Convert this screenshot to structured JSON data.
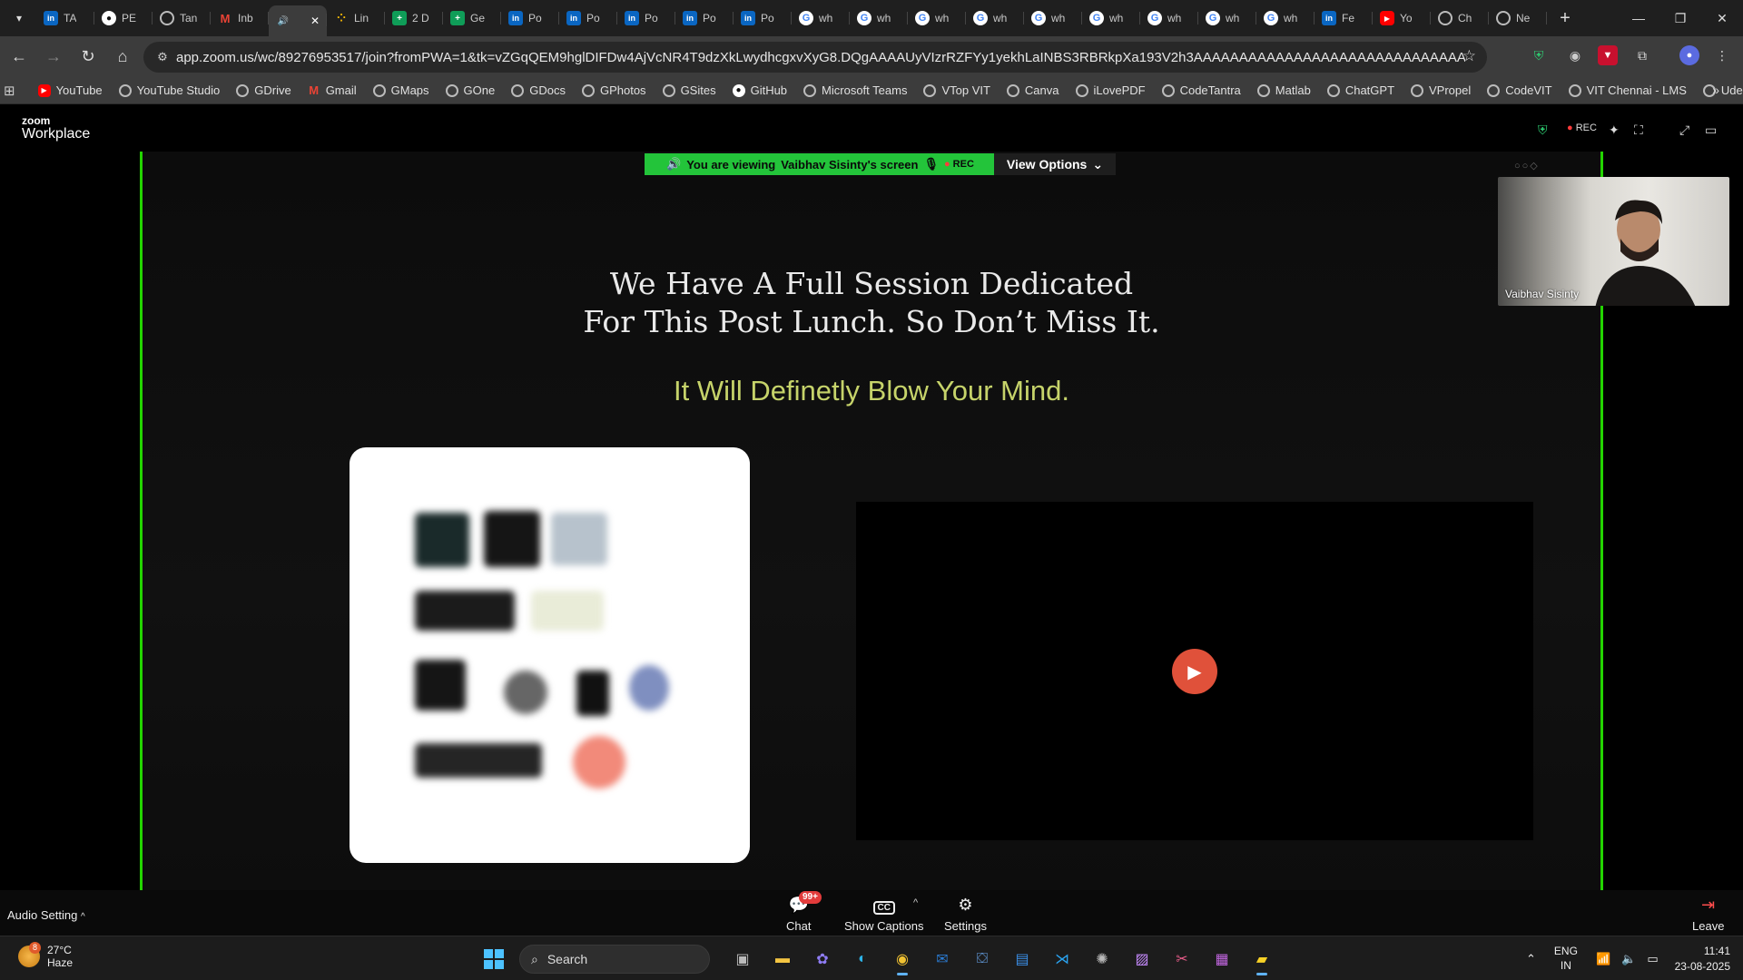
{
  "browser": {
    "tabs": [
      {
        "favicon": "linkedin-icon",
        "label": "TA"
      },
      {
        "favicon": "github-icon",
        "label": "PE"
      },
      {
        "favicon": "globe-icon",
        "label": "Tan"
      },
      {
        "favicon": "gmail-icon",
        "label": "Inb"
      },
      {
        "favicon": "speaker-icon",
        "label": "",
        "active": true
      },
      {
        "favicon": "app-icon",
        "label": "Lin"
      },
      {
        "favicon": "sheets-icon",
        "label": "2 D"
      },
      {
        "favicon": "sheets-icon",
        "label": "Ge"
      },
      {
        "favicon": "linkedin-icon",
        "label": "Po"
      },
      {
        "favicon": "linkedin-icon",
        "label": "Po"
      },
      {
        "favicon": "linkedin-icon",
        "label": "Po"
      },
      {
        "favicon": "linkedin-icon",
        "label": "Po"
      },
      {
        "favicon": "linkedin-icon",
        "label": "Po"
      },
      {
        "favicon": "google-icon",
        "label": "wh"
      },
      {
        "favicon": "google-icon",
        "label": "wh"
      },
      {
        "favicon": "google-icon",
        "label": "wh"
      },
      {
        "favicon": "google-icon",
        "label": "wh"
      },
      {
        "favicon": "google-icon",
        "label": "wh"
      },
      {
        "favicon": "google-icon",
        "label": "wh"
      },
      {
        "favicon": "google-icon",
        "label": "wh"
      },
      {
        "favicon": "google-icon",
        "label": "wh"
      },
      {
        "favicon": "google-icon",
        "label": "wh"
      },
      {
        "favicon": "linkedin-icon",
        "label": "Fe"
      },
      {
        "favicon": "youtube-icon",
        "label": "Yo"
      },
      {
        "favicon": "chatgpt-icon",
        "label": "Ch"
      },
      {
        "favicon": "globe-icon",
        "label": "Ne"
      }
    ],
    "url": "app.zoom.us/wc/89276953517/join?fromPWA=1&tk=vZGqQEM9hglDIFDw4AjVcNR4T9dzXkLwydhcgxvXyG8.DQgAAAAUyVIzrRZFYy1yekhLaINBS3RBRkpXa193V2h3AAAAAAAAAAAAAAAAAAAAAAAAAAAAAAAAAAAAAAAA&_x_zm_r...",
    "bookmarks": [
      {
        "favicon": "youtube-icon",
        "label": "YouTube"
      },
      {
        "favicon": "globe-icon",
        "label": "YouTube Studio"
      },
      {
        "favicon": "globe-icon",
        "label": "GDrive"
      },
      {
        "favicon": "gmail-icon",
        "label": "Gmail"
      },
      {
        "favicon": "globe-icon",
        "label": "GMaps"
      },
      {
        "favicon": "globe-icon",
        "label": "GOne"
      },
      {
        "favicon": "globe-icon",
        "label": "GDocs"
      },
      {
        "favicon": "globe-icon",
        "label": "GPhotos"
      },
      {
        "favicon": "globe-icon",
        "label": "GSites"
      },
      {
        "favicon": "github-icon",
        "label": "GitHub"
      },
      {
        "favicon": "globe-icon",
        "label": "Microsoft Teams"
      },
      {
        "favicon": "globe-icon",
        "label": "VTop VIT"
      },
      {
        "favicon": "globe-icon",
        "label": "Canva"
      },
      {
        "favicon": "globe-icon",
        "label": "iLovePDF"
      },
      {
        "favicon": "globe-icon",
        "label": "CodeTantra"
      },
      {
        "favicon": "globe-icon",
        "label": "Matlab"
      },
      {
        "favicon": "chatgpt-icon",
        "label": "ChatGPT"
      },
      {
        "favicon": "globe-icon",
        "label": "VPropel"
      },
      {
        "favicon": "globe-icon",
        "label": "CodeVIT"
      },
      {
        "favicon": "globe-icon",
        "label": "VIT Chennai - LMS"
      },
      {
        "favicon": "globe-icon",
        "label": "Udemy"
      }
    ]
  },
  "zoom": {
    "logo_small": "zoom",
    "logo_big": "Workplace",
    "rec_label": "REC",
    "banner": {
      "viewing_prefix": "You are viewing",
      "viewing_name": "Vaibhav Sisinty's screen",
      "rec": "REC",
      "view_options": "View Options"
    },
    "shared_screen": {
      "headline_line1": "We Have A Full Session Dedicated",
      "headline_line2": "For This Post Lunch. So Don’t Miss It.",
      "tagline": "It Will Definetly Blow Your Mind."
    },
    "participant": {
      "name": "Vaibhav Sisinty"
    },
    "bottom": {
      "audio_setting": "Audio Setting",
      "chat_label": "Chat",
      "chat_badge": "99+",
      "captions_label": "Show Captions",
      "captions_icon_text": "CC",
      "settings_label": "Settings",
      "leave_label": "Leave"
    }
  },
  "taskbar": {
    "weather_temp": "27°C",
    "weather_desc": "Haze",
    "weather_badge": "8",
    "search_label": "Search",
    "lang_line1": "ENG",
    "lang_line2": "IN",
    "time": "11:41",
    "date": "23-08-2025"
  },
  "colors": {
    "share_border": "#23d400",
    "banner_green": "#23c43a",
    "tagline": "#c6d36a",
    "play": "#e0513a"
  }
}
